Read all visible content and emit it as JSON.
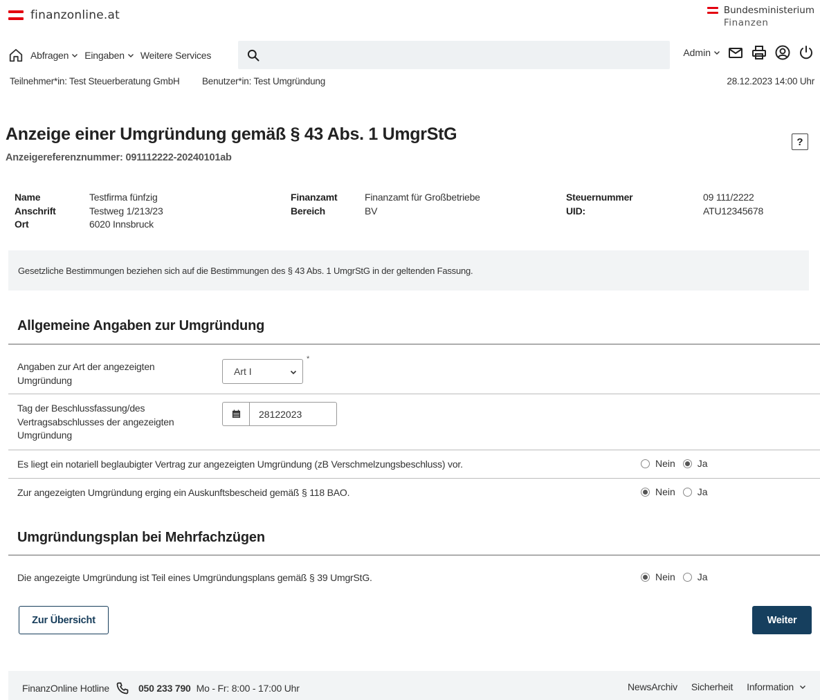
{
  "header": {
    "site_name": "finanzonline.at",
    "ministry_line1": "Bundesministerium",
    "ministry_line2": "Finanzen",
    "brand_color": "#e3000f"
  },
  "nav": {
    "items": [
      {
        "label": "Abfragen"
      },
      {
        "label": "Eingaben"
      },
      {
        "label": "Weitere Services"
      }
    ],
    "search_placeholder": "",
    "user_label": "Admin"
  },
  "subheader": {
    "participant": "Teilnehmer*in: Test Steuerberatung GmbH",
    "user": "Benutzer*in: Test Umgründung",
    "datetime": "28.12.2023 14:00 Uhr"
  },
  "page": {
    "title": "Anzeige einer Umgründung gemäß § 43 Abs. 1 UmgrStG",
    "reference": "Anzeigereferenznummer: 091112222-20240101ab",
    "help_label": "?"
  },
  "company": {
    "name_label": "Name",
    "name_value": "Testfirma fünfzig",
    "address_label": "Anschrift",
    "address_value": "Testweg 1/213/23",
    "city_label": "Ort",
    "city_value": "6020 Innsbruck",
    "office_label": "Finanzamt",
    "office_value": "Finanzamt für Großbetriebe",
    "area_label": "Bereich",
    "area_value": "BV",
    "taxno_label": "Steuernummer",
    "taxno_value": "09 111/2222",
    "uid_label": "UID:",
    "uid_value": "ATU12345678"
  },
  "notice": "Gesetzliche Bestimmungen beziehen sich auf die Bestimmungen des § 43 Abs. 1 UmgrStG in der geltenden Fassung.",
  "section1": {
    "heading": "Allgemeine Angaben zur Umgründung",
    "art_label_1": "Angaben zur Art der angezeigten",
    "art_label_2": "Umgründung",
    "art_value": "Art I",
    "required_mark": "*",
    "date_label_1": "Tag der Beschlussfassung/des",
    "date_label_2": "Vertragsabschlusses der angezeigten",
    "date_label_3": "Umgründung",
    "date_value": "28122023",
    "q1_label": "Es liegt ein notariell beglaubigter Vertrag zur angezeigten Umgründung (zB Verschmelzungsbeschluss) vor.",
    "q1_selected": "Ja",
    "q2_label": "Zur angezeigten Umgründung erging ein Auskunftsbescheid gemäß § 118 BAO.",
    "q2_selected": "Nein",
    "opt_no": "Nein",
    "opt_yes": "Ja"
  },
  "section2": {
    "heading": "Umgründungsplan bei Mehrfachzügen",
    "q3_label": "Die angezeigte Umgründung ist Teil eines Umgründungsplans gemäß § 39 UmgrStG.",
    "q3_selected": "Nein"
  },
  "buttons": {
    "overview": "Zur Übersicht",
    "next": "Weiter",
    "primary_color": "#163f5e"
  },
  "footer": {
    "hotline_label": "FinanzOnline Hotline",
    "hotline_number": "050 233 790",
    "hours": "Mo - Fr: 8:00 - 17:00 Uhr",
    "links": [
      "NewsArchiv",
      "Sicherheit",
      "Information"
    ]
  }
}
